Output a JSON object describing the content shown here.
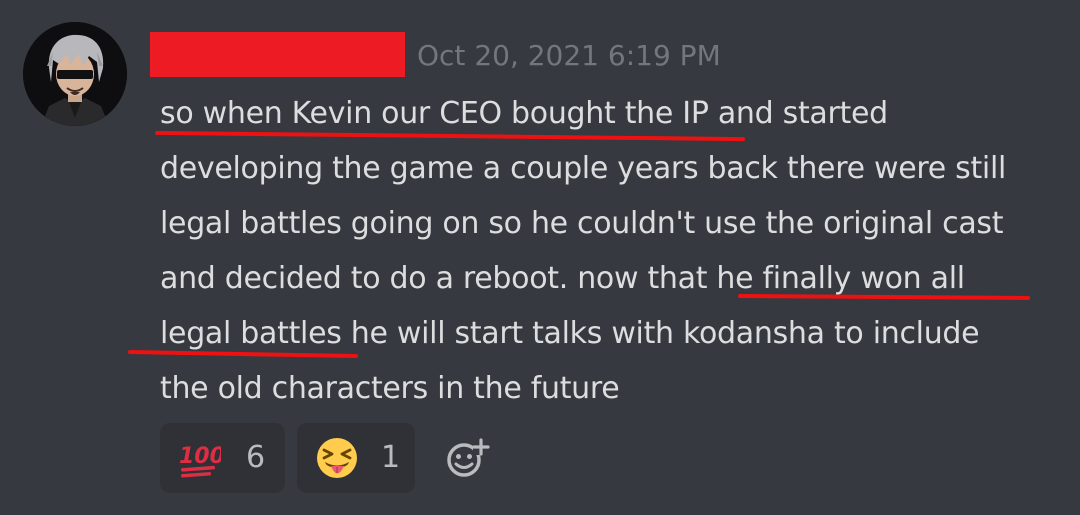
{
  "message": {
    "timestamp": "Oct 20, 2021 6:19 PM",
    "lines": [
      "so when Kevin our CEO bought the IP and started",
      "developing the game a couple years back there were still",
      "legal battles going on so he couldn't use the original cast",
      "and decided to do a reboot. now that he finally won all",
      "legal battles he will start talks with kodansha to include",
      "the old characters in the future"
    ]
  },
  "reactions": [
    {
      "emoji": "hundred-points",
      "count": "6"
    },
    {
      "emoji": "squinting-face-with-tongue",
      "count": "1"
    }
  ],
  "colors": {
    "background": "#36393f",
    "text": "#dcddde",
    "timestamp": "#72767d",
    "redaction": "#ed1c24",
    "underline": "#ee1111",
    "reaction_bg": "#2f3136"
  }
}
